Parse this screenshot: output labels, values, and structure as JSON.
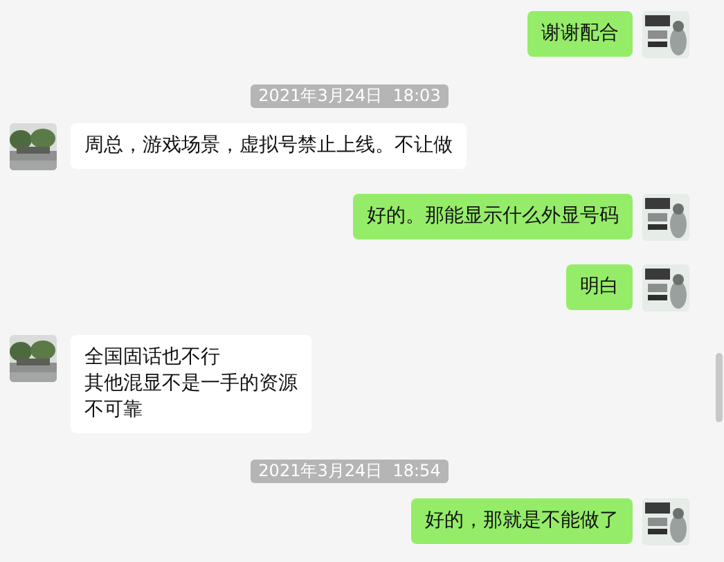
{
  "messages": [
    {
      "kind": "message",
      "outgoing": true,
      "lines": [
        "谢谢配合"
      ]
    },
    {
      "kind": "time",
      "text": "2021年3月24日  18:03"
    },
    {
      "kind": "message",
      "outgoing": false,
      "lines": [
        "周总，游戏场景，虚拟号禁止上线。不让做"
      ]
    },
    {
      "kind": "message",
      "outgoing": true,
      "lines": [
        "好的。那能显示什么外显号码"
      ]
    },
    {
      "kind": "message",
      "outgoing": true,
      "lines": [
        "明白"
      ]
    },
    {
      "kind": "message",
      "outgoing": false,
      "lines": [
        "全国固话也不行",
        "其他混显不是一手的资源",
        "不可靠"
      ]
    },
    {
      "kind": "time",
      "text": "2021年3月24日  18:54"
    },
    {
      "kind": "message",
      "outgoing": true,
      "lines": [
        "好的，那就是不能做了"
      ]
    }
  ]
}
